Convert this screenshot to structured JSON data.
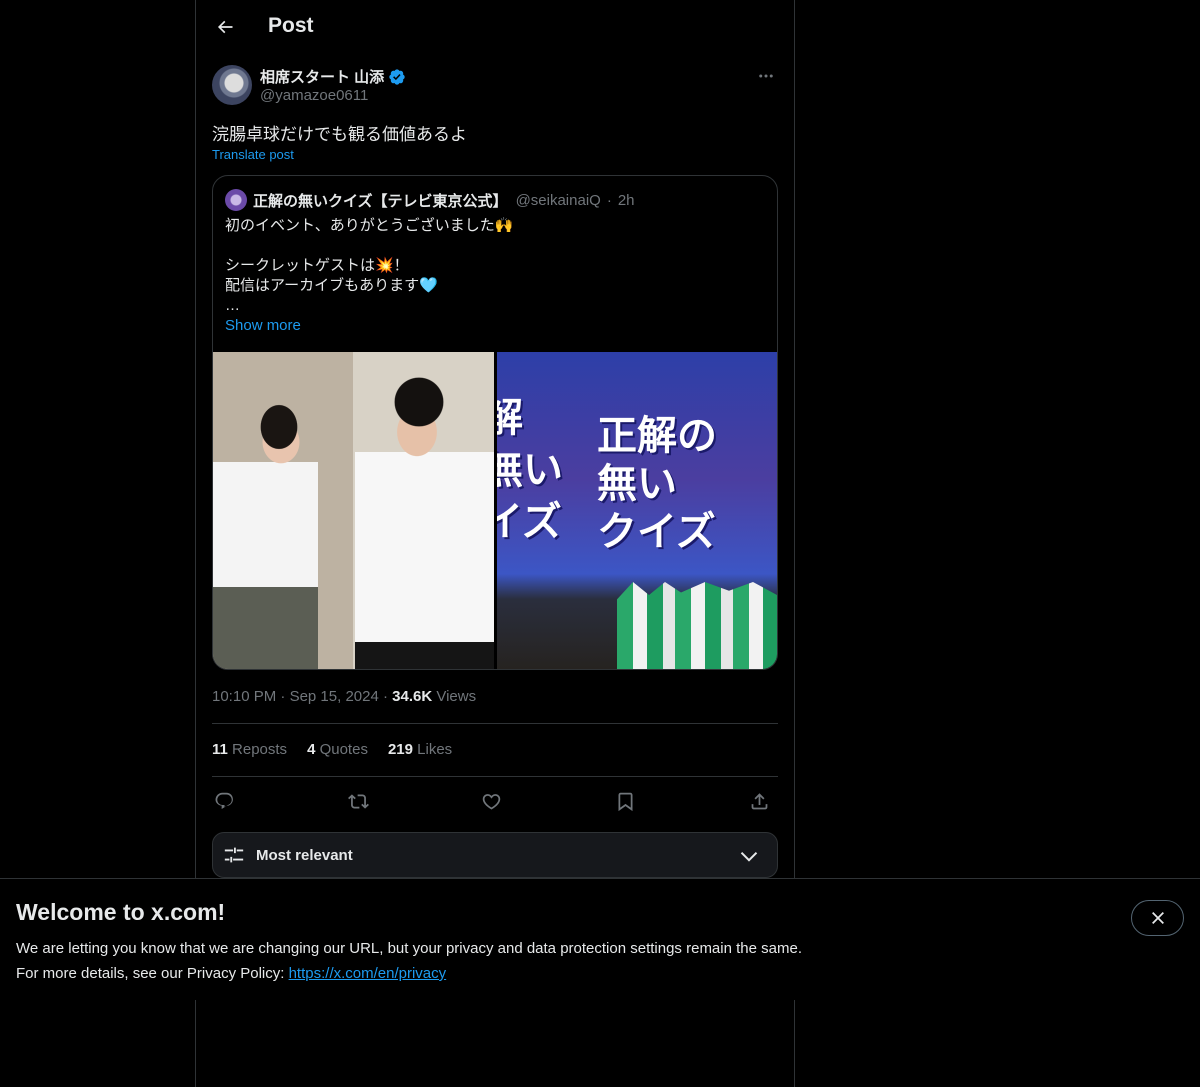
{
  "header": {
    "title": "Post"
  },
  "post": {
    "author_name": "相席スタート 山添",
    "author_handle": "@yamazoe0611",
    "text": "浣腸卓球だけでも観る価値あるよ",
    "translate_label": "Translate post",
    "time": "10:10 PM",
    "date": "Sep 15, 2024",
    "views_count": "34.6K",
    "views_label": "Views"
  },
  "quote": {
    "name": "正解の無いクイズ【テレビ東京公式】",
    "handle": "@seikainaiQ",
    "sep": "·",
    "age": "2h",
    "lines": [
      "初のイベント、ありがとうございました🙌",
      "",
      "シークレットゲストは💥！",
      "配信はアーカイブもあります🩵",
      "…"
    ],
    "show_more": "Show more",
    "screen_text_right": "正解の\n無い\nクイズ",
    "screen_text_left": "解\n無い\nイズ"
  },
  "stats": {
    "reposts_count": "11",
    "reposts_label": "Reposts",
    "quotes_count": "4",
    "quotes_label": "Quotes",
    "likes_count": "219",
    "likes_label": "Likes"
  },
  "sort": {
    "label": "Most relevant"
  },
  "banner": {
    "title": "Welcome to x.com!",
    "line1": "We are letting you know that we are changing our URL, but your privacy and data protection settings remain the same.",
    "line2_prefix": "For more details, see our Privacy Policy: ",
    "link": "https://x.com/en/privacy"
  },
  "icons": {
    "back": "arrow-left-icon",
    "verified": "verified-badge-icon",
    "more": "more-icon",
    "reply": "reply-icon",
    "repost": "repost-icon",
    "like": "heart-icon",
    "bookmark": "bookmark-icon",
    "share": "share-icon",
    "sort": "sliders-icon",
    "chevron": "chevron-down-icon",
    "close": "close-icon"
  },
  "colors": {
    "accent": "#1d9bf0",
    "background": "#000000",
    "text": "#e7e9ea",
    "muted": "#71767b",
    "border": "#2f3336"
  }
}
